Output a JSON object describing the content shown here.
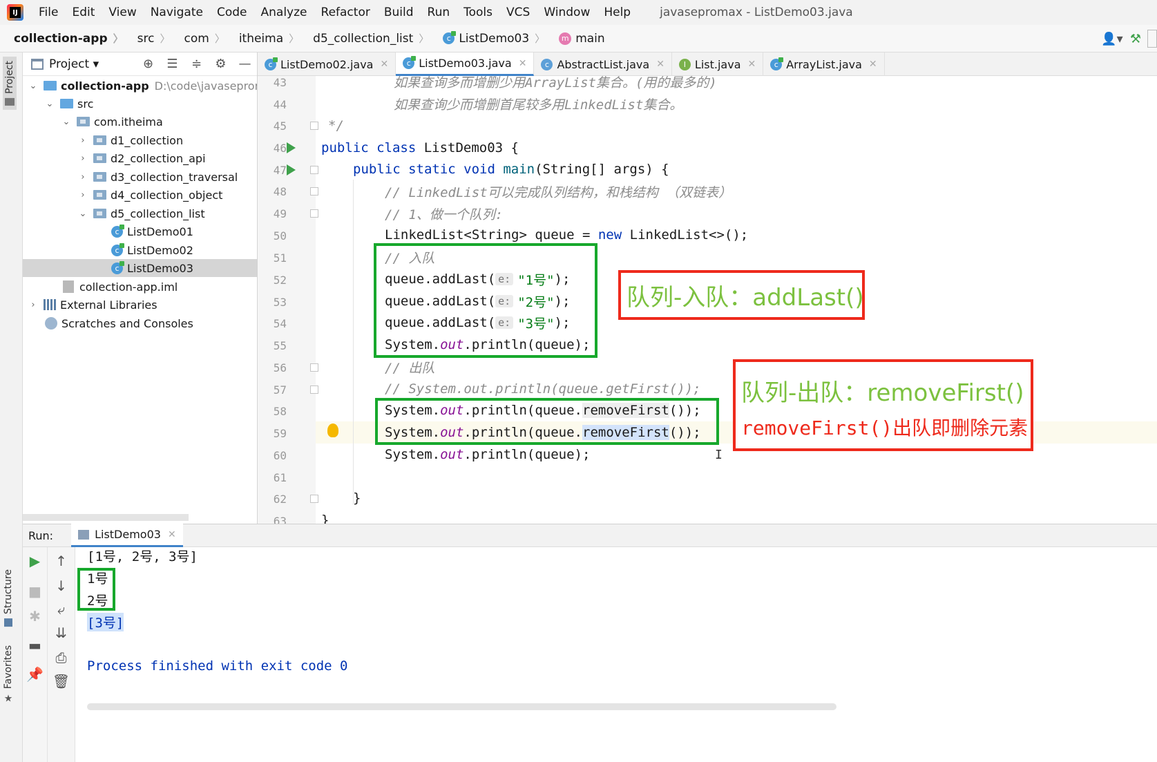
{
  "menubar": {
    "logo_letter": "IJ",
    "items": [
      "File",
      "Edit",
      "View",
      "Navigate",
      "Code",
      "Analyze",
      "Refactor",
      "Build",
      "Run",
      "Tools",
      "VCS",
      "Window",
      "Help"
    ],
    "window_title": "javasepromax - ListDemo03.java"
  },
  "breadcrumb": {
    "items": [
      "collection-app",
      "src",
      "com",
      "itheima",
      "d5_collection_list",
      "ListDemo03",
      "main"
    ],
    "separator": "〉"
  },
  "left_strip": {
    "project": "Project",
    "structure": "Structure",
    "favorites": "Favorites"
  },
  "project_panel": {
    "title": "Project",
    "tree": [
      {
        "label": "collection-app",
        "extra": "D:\\code\\javasepromax",
        "icon": "module-folder"
      },
      {
        "label": "src",
        "icon": "source-folder"
      },
      {
        "label": "com.itheima",
        "icon": "package-folder"
      },
      {
        "label": "d1_collection",
        "icon": "package-folder"
      },
      {
        "label": "d2_collection_api",
        "icon": "package-folder"
      },
      {
        "label": "d3_collection_traversal",
        "icon": "package-folder"
      },
      {
        "label": "d4_collection_object",
        "icon": "package-folder"
      },
      {
        "label": "d5_collection_list",
        "icon": "package-folder"
      },
      {
        "label": "ListDemo01",
        "icon": "class-icon"
      },
      {
        "label": "ListDemo02",
        "icon": "class-icon"
      },
      {
        "label": "ListDemo03",
        "icon": "class-icon"
      },
      {
        "label": "collection-app.iml",
        "icon": "iml-file"
      },
      {
        "label": "External Libraries",
        "icon": "libraries"
      },
      {
        "label": "Scratches and Consoles",
        "icon": "scratches"
      }
    ]
  },
  "editor_tabs": [
    {
      "label": "ListDemo02.java",
      "icon": "class-icon"
    },
    {
      "label": "ListDemo03.java",
      "icon": "class-icon"
    },
    {
      "label": "AbstractList.java",
      "icon": "abstract-class-icon"
    },
    {
      "label": "List.java",
      "icon": "interface-icon"
    },
    {
      "label": "ArrayList.java",
      "icon": "class-icon"
    }
  ],
  "editor": {
    "line_numbers": [
      "43",
      "44",
      "45",
      "46",
      "47",
      "48",
      "49",
      "50",
      "51",
      "52",
      "53",
      "54",
      "55",
      "56",
      "57",
      "58",
      "59",
      "60",
      "61",
      "62",
      "63"
    ],
    "lines": {
      "l43": "如果查询多而增删少用ArrayList集合。(用的最多的)",
      "l44": "如果查询少而增删首尾较多用LinkedList集合。",
      "l45": "*/",
      "l46_kw": "public class",
      "l46_rest": " ListDemo03 {",
      "l47_kw": "public static void",
      "l47_method": " main",
      "l47_rest": "(String[] args) {",
      "l48": "// LinkedList可以完成队列结构，和栈结构 （双链表）",
      "l49": "// 1、做一个队列:",
      "l50_a": "LinkedList<String> queue = ",
      "l50_kw": "new",
      "l50_b": " LinkedList<>();",
      "l51": "// 入队",
      "add_prefix": "queue.addLast(",
      "hint": "e:",
      "add_suffix": ");",
      "l52_str": "\"1号\"",
      "l53_str": "\"2号\"",
      "l54_str": "\"3号\"",
      "sys": "System.",
      "out": "out",
      "println_queue": ".println(queue);",
      "l56": "// 出队",
      "l57": "// System.out.println(queue.getFirst());",
      "println_open": ".println(queue.",
      "remove": "removeFirst",
      "println_close": "());",
      "l62": "}",
      "l63": "}"
    }
  },
  "annotations": {
    "enqueue": "队列-入队：addLast()",
    "dequeue": "队列-出队：removeFirst()",
    "dequeue_note": "removeFirst()出队即删除元素"
  },
  "run": {
    "label": "Run:",
    "tab": "ListDemo03",
    "output": [
      "[1号, 2号, 3号]",
      "1号",
      "2号",
      "[3号]",
      "",
      "Process finished with exit code 0"
    ]
  },
  "colors": {
    "keyword": "#0033b3",
    "string": "#067d17",
    "comment": "#8c8c8c",
    "field": "#871094",
    "annotation_green": "#7cc13f",
    "annotation_red": "#ee2a1c",
    "box_green": "#17a82c"
  }
}
